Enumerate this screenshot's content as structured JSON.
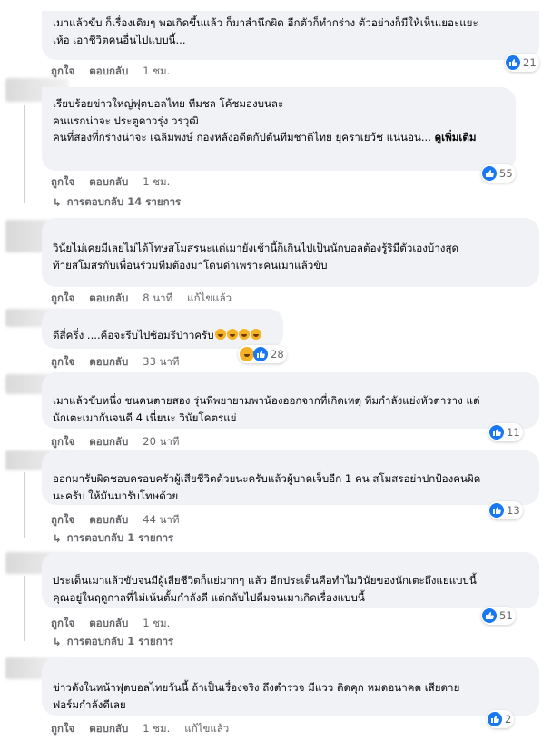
{
  "ui": {
    "accent": "#1877f2",
    "like_label": "ถูกใจ",
    "reply_label": "ตอบกลับ"
  },
  "comments": [
    {
      "lines": [
        "เมาแล้วขับ ก็เรื่องเดิมๆ พอเกิดขึ้นแล้ว ก็มาสำนึกผิด อีกตัวก็ทำกร่าง ตัวอย่างก็มีให้เห็นเยอะแยะ",
        "เห้อ เอาชีวิตคนอื่นไปแบบนี้..."
      ],
      "time": "1 ชม.",
      "edited": "",
      "reactions": "21",
      "replies": ""
    },
    {
      "lines": [
        "เรียบร้อยข่าวใหญ่ฟุตบอลไทย ทีมชล โค้ชมองบนละ",
        "คนแรกน่าจะ ประตูดาวรุ่ง วรวุฒิ",
        "คนที่สองที่กร่างน่าจะ เฉลิมพงษ์ กองหลังอดีตกัปตันทีมชาติไทย ยุคราเยวัช แน่นอน... "
      ],
      "see_more": "ดูเพิ่มเติม",
      "time": "1 ชม.",
      "edited": "",
      "reactions": "55",
      "replies": "การตอบกลับ 14 รายการ"
    },
    {
      "lines": [
        "วินัยไม่เคยมีเลยไม่ได้โทษสโมสรนะแต่เมายังเช้านี้ก็เกินไปเป็นนักบอลต้องรู้ริมีตัวเองบ้างสุด",
        "ท้ายสโมสรกับเพื่อนร่วมทีมต้องมาโดนด่าเพราะคนเมาแล้วขับ"
      ],
      "time": "8 นาที",
      "edited": "แก้ไขแล้ว",
      "reactions": "",
      "replies": ""
    },
    {
      "lines": [
        "ดีสี่ครึ่ง ....คือจะรีบไปซ้อมรึป่าวครับ"
      ],
      "time": "33 นาที",
      "edited": "",
      "reactions": "28",
      "replies": ""
    },
    {
      "lines": [
        "เมาแล้วขับหนึ่ง ชนคนตายสอง รุ่นพี่พยายามพาน้องออกจากที่เกิดเหตุ ทีมกำลังแย่งหัวตาราง แต่",
        "นักเตะเมากันจนดี 4 เนี่ยนะ วินัยโคตรแย่"
      ],
      "time": "20 นาที",
      "edited": "",
      "reactions": "11",
      "replies": ""
    },
    {
      "lines": [
        "ออกมารับผิดชอบครอบครัวผู้เสียชีวิตด้วยนะครับแล้วผู้บาดเจ็บอีก 1 คน สโมสรอย่าปกป้องคนผิด",
        "นะครับ ให้มันมารับโทษด้วย"
      ],
      "time": "44 นาที",
      "edited": "",
      "reactions": "13",
      "replies": "การตอบกลับ 1 รายการ"
    },
    {
      "lines": [
        "ประเด็นเมาแล้วขับจนมีผู้เสียชีวิตก็แย่มากๆ แล้ว อีกประเด็นคือทำไมวินัยของนักเตะถึงแย่แบบนี้",
        "คุณอยู่ในฤดูกาลที่ไม่เน้นตั้มกำลังดี แต่กลับไปดื่มจนเมาเกิดเรื่องแบบนี้"
      ],
      "time": "1 ชม.",
      "edited": "",
      "reactions": "51",
      "replies": "การตอบกลับ 1 รายการ"
    },
    {
      "lines": [
        "ข่าวดังในหน้าฟุตบอลไทยวันนี้ ถ้าเป็นเรื่องจริง ถึงตำรวจ มีแวว ติดคุก หมดอนาคต เสียดาย",
        "ฟอร์มกำลังดีเลย"
      ],
      "time": "1 ชม.",
      "edited": "แก้ไขแล้ว",
      "reactions": "2",
      "replies": ""
    }
  ]
}
